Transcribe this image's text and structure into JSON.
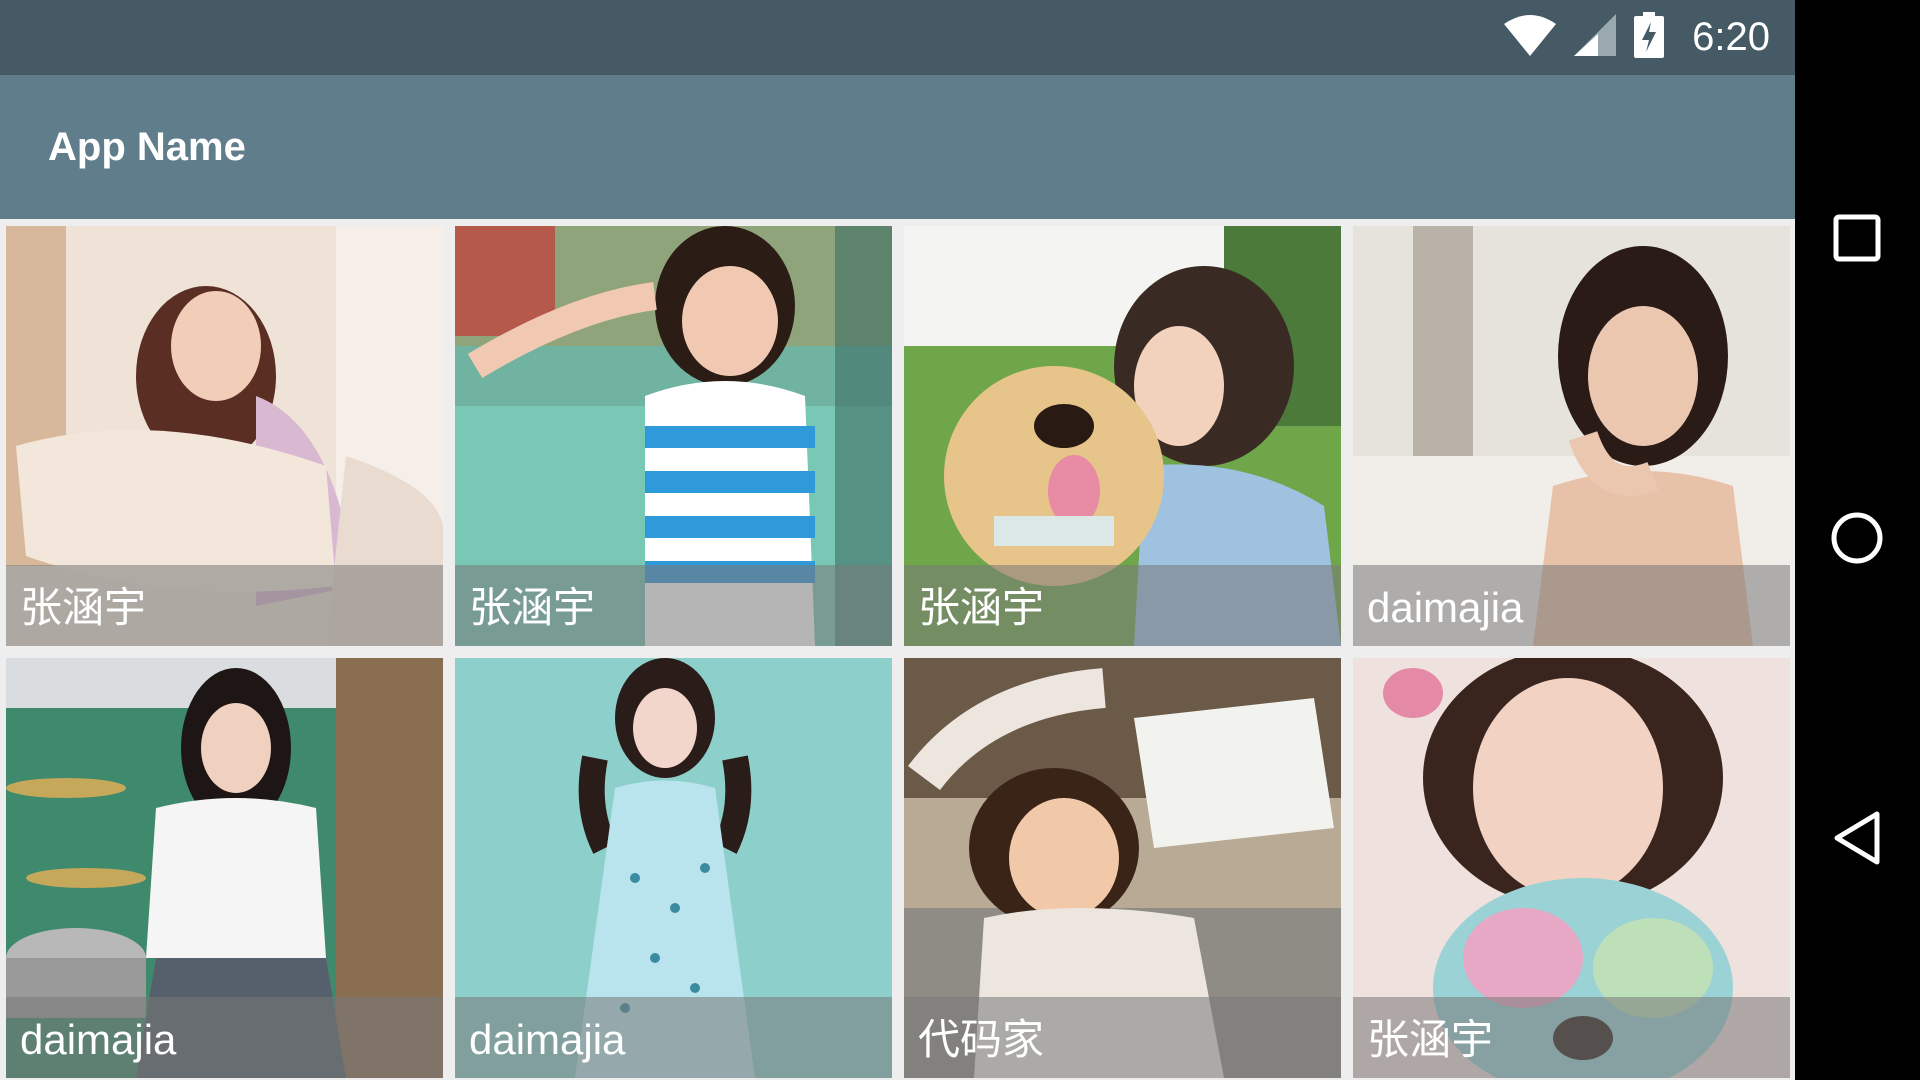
{
  "status_bar": {
    "time": "6:20",
    "icons": [
      "wifi-icon",
      "signal-icon",
      "battery-charging-icon"
    ]
  },
  "app_bar": {
    "title": "App Name"
  },
  "grid": {
    "items": [
      {
        "label": "张涵宇",
        "photo": "woman-hugging-pillow"
      },
      {
        "label": "张涵宇",
        "photo": "girl-striped-top-peace-sign"
      },
      {
        "label": "张涵宇",
        "photo": "woman-kissing-golden-retriever"
      },
      {
        "label": "daimajia",
        "photo": "woman-chin-on-hand"
      },
      {
        "label": "daimajia",
        "photo": "girl-with-drum-kit"
      },
      {
        "label": "daimajia",
        "photo": "girl-blue-dress-teal-background"
      },
      {
        "label": "代码家",
        "photo": "girl-with-im-busy-bag"
      },
      {
        "label": "张涵宇",
        "photo": "girl-with-teddy-bear"
      }
    ]
  },
  "nav_bar": {
    "buttons": [
      "recents-square-icon",
      "home-circle-icon",
      "back-triangle-icon"
    ]
  },
  "colors": {
    "status_bar": "#455a64",
    "app_bar": "#607d8b",
    "background": "#eeeeee",
    "caption_overlay": "rgba(120,120,120,0.55)"
  }
}
